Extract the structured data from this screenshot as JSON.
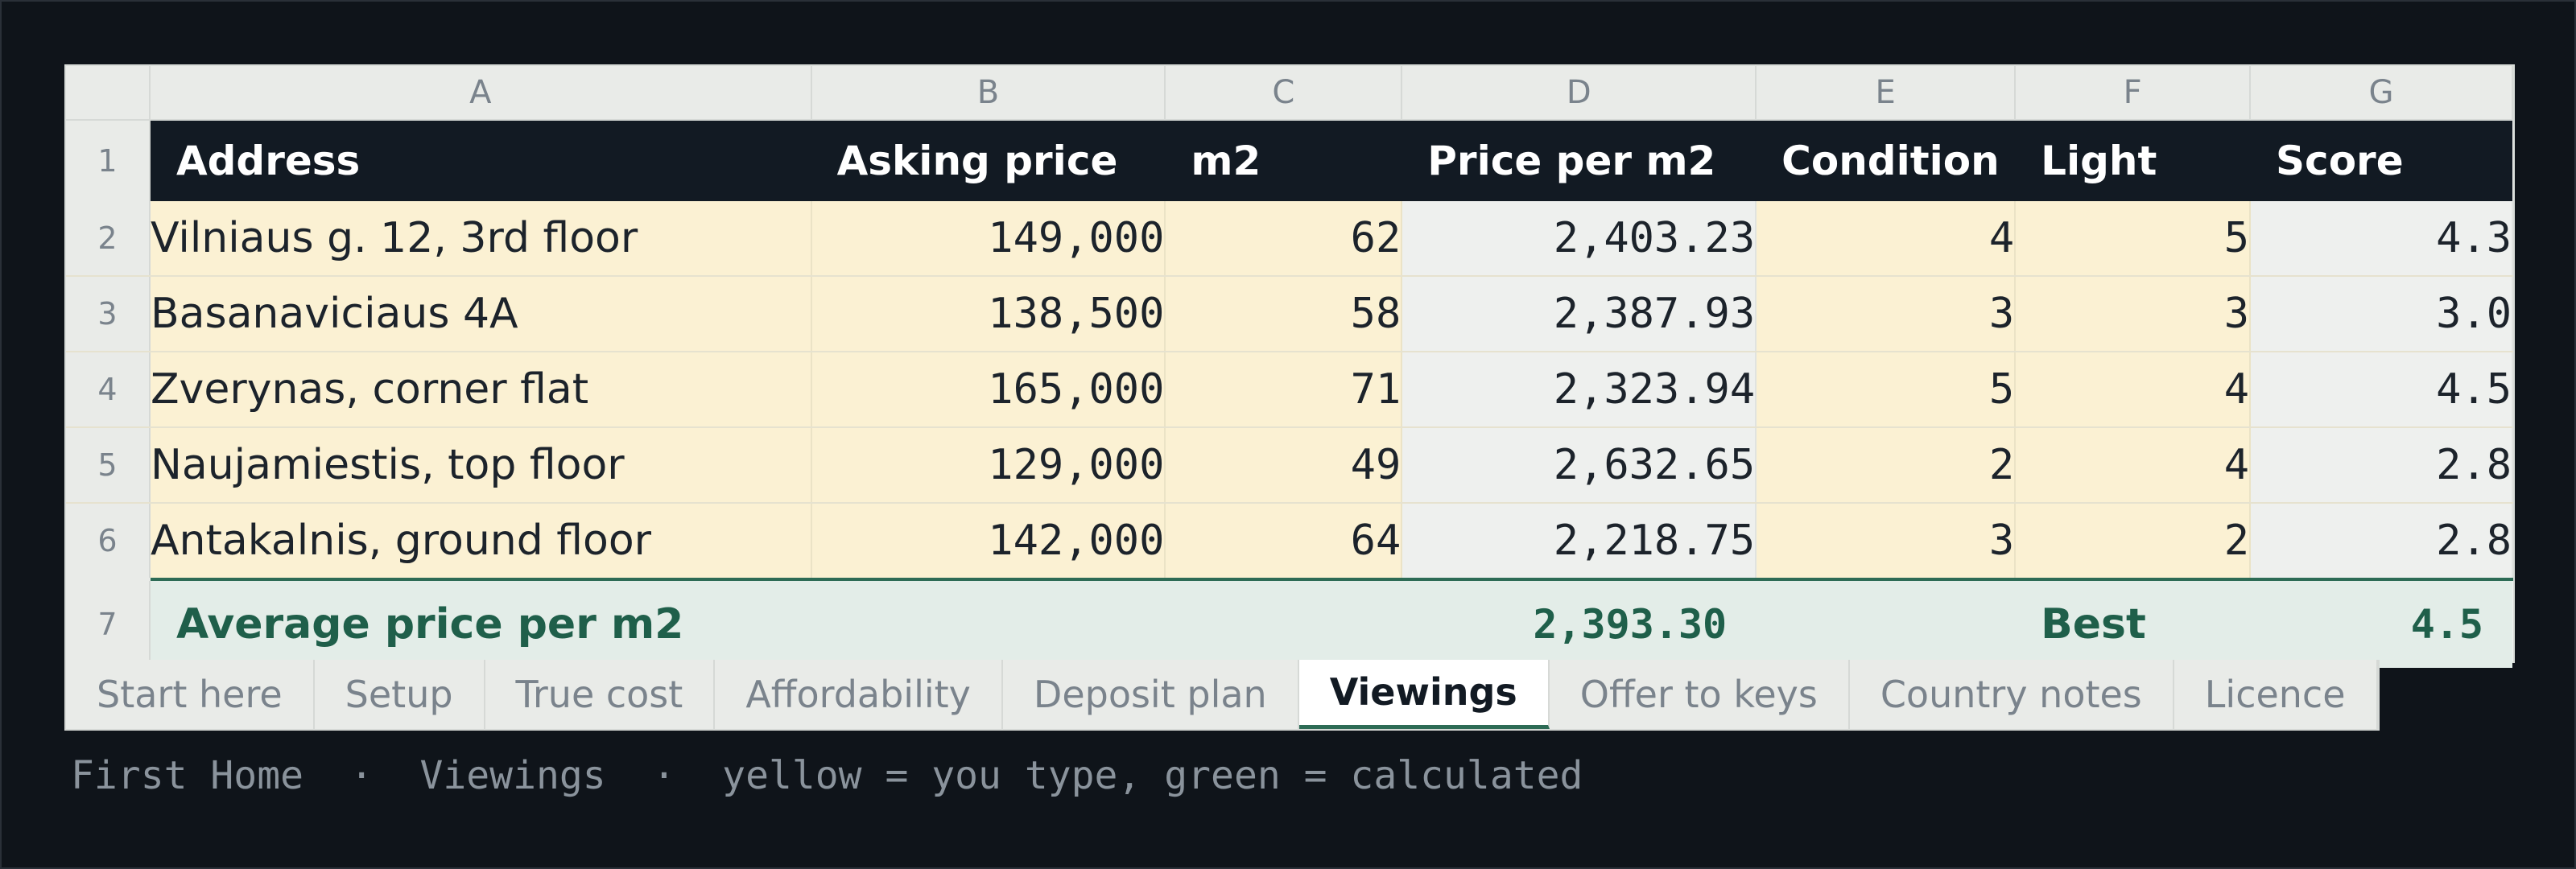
{
  "columns": [
    "A",
    "B",
    "C",
    "D",
    "E",
    "F",
    "G"
  ],
  "row_numbers": [
    "1",
    "2",
    "3",
    "4",
    "5",
    "6",
    "7"
  ],
  "headers": [
    "Address",
    "Asking price",
    "m2",
    "Price per m2",
    "Condition",
    "Light",
    "Score"
  ],
  "rows": [
    [
      "Vilniaus g. 12, 3rd floor",
      "149,000",
      "62",
      "2,403.23",
      "4",
      "5",
      "4.3"
    ],
    [
      "Basanaviciaus 4A",
      "138,500",
      "58",
      "2,387.93",
      "3",
      "3",
      "3.0"
    ],
    [
      "Zverynas, corner flat",
      "165,000",
      "71",
      "2,323.94",
      "5",
      "4",
      "4.5"
    ],
    [
      "Naujamiestis, top floor",
      "129,000",
      "49",
      "2,632.65",
      "2",
      "4",
      "2.8"
    ],
    [
      "Antakalnis, ground floor",
      "142,000",
      "64",
      "2,218.75",
      "3",
      "2",
      "2.8"
    ]
  ],
  "totals": {
    "label": "Average price per m2",
    "avg_price": "2,393.30",
    "best_label": "Best",
    "best_score": "4.5"
  },
  "tabs": [
    "Start here",
    "Setup",
    "True cost",
    "Affordability",
    "Deposit plan",
    "Viewings",
    "Offer to keys",
    "Country notes",
    "Licence"
  ],
  "active_tab": "Viewings",
  "footer": {
    "app": "First Home",
    "sep": "·",
    "sheet": "Viewings",
    "legend": "yellow = you type, green = calculated"
  },
  "colors": {
    "input_fill": "#fbf1d3",
    "calculated_text": "#1e5e4c",
    "header_fill": "#121a23"
  }
}
